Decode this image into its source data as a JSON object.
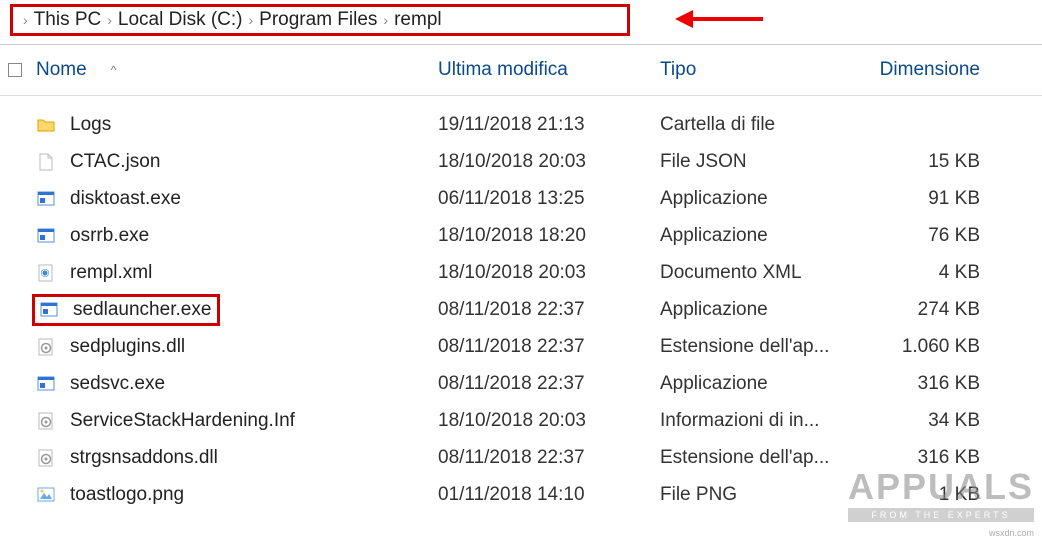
{
  "breadcrumb": [
    "This PC",
    "Local Disk (C:)",
    "Program Files",
    "rempl"
  ],
  "columns": {
    "name": "Nome",
    "modified": "Ultima modifica",
    "type": "Tipo",
    "size": "Dimensione"
  },
  "files": [
    {
      "icon": "folder",
      "name": "Logs",
      "modified": "19/11/2018 21:13",
      "type": "Cartella di file",
      "size": "",
      "highlight": false
    },
    {
      "icon": "file",
      "name": "CTAC.json",
      "modified": "18/10/2018 20:03",
      "type": "File JSON",
      "size": "15 KB",
      "highlight": false
    },
    {
      "icon": "exe",
      "name": "disktoast.exe",
      "modified": "06/11/2018 13:25",
      "type": "Applicazione",
      "size": "91 KB",
      "highlight": false
    },
    {
      "icon": "exe",
      "name": "osrrb.exe",
      "modified": "18/10/2018 18:20",
      "type": "Applicazione",
      "size": "76 KB",
      "highlight": false
    },
    {
      "icon": "xml",
      "name": "rempl.xml",
      "modified": "18/10/2018 20:03",
      "type": "Documento XML",
      "size": "4 KB",
      "highlight": false
    },
    {
      "icon": "exe",
      "name": "sedlauncher.exe",
      "modified": "08/11/2018 22:37",
      "type": "Applicazione",
      "size": "274 KB",
      "highlight": true
    },
    {
      "icon": "dll",
      "name": "sedplugins.dll",
      "modified": "08/11/2018 22:37",
      "type": "Estensione dell'ap...",
      "size": "1.060 KB",
      "highlight": false
    },
    {
      "icon": "exe",
      "name": "sedsvc.exe",
      "modified": "08/11/2018 22:37",
      "type": "Applicazione",
      "size": "316 KB",
      "highlight": false
    },
    {
      "icon": "inf",
      "name": "ServiceStackHardening.Inf",
      "modified": "18/10/2018 20:03",
      "type": "Informazioni di in...",
      "size": "34 KB",
      "highlight": false
    },
    {
      "icon": "dll",
      "name": "strgsnsaddons.dll",
      "modified": "08/11/2018 22:37",
      "type": "Estensione dell'ap...",
      "size": "316 KB",
      "highlight": false
    },
    {
      "icon": "png",
      "name": "toastlogo.png",
      "modified": "01/11/2018 14:10",
      "type": "File PNG",
      "size": "1 KB",
      "highlight": false
    }
  ],
  "watermark": {
    "main": "APPUALS",
    "sub": "FROM THE EXPERTS",
    "url": "wsxdn.com"
  }
}
